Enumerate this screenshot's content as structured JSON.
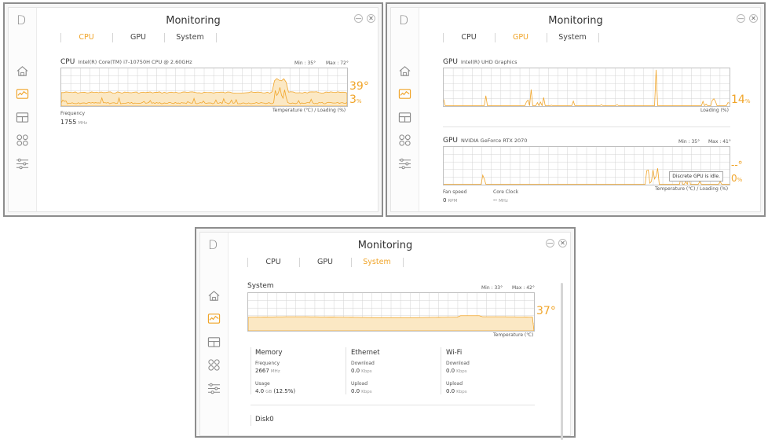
{
  "app": {
    "logo": "D",
    "title": "Monitoring",
    "tabs": [
      "CPU",
      "GPU",
      "System"
    ],
    "minimize_glyph": "—",
    "close_glyph": "✕",
    "nav_icons": [
      "home-icon",
      "monitoring-icon",
      "layout-icon",
      "apps-icon",
      "settings-sliders-icon"
    ]
  },
  "colors": {
    "accent": "#f0a428",
    "grid": "#d2d2d2",
    "panel_border": "#8d8d8d"
  },
  "cpu_view": {
    "active_tab": "CPU",
    "cpu_label": "CPU",
    "cpu_name": "Intel(R) Core(TM) i7-10750H CPU @ 2.60GHz",
    "min_label": "Min : 35°",
    "max_label": "Max : 72°",
    "temp_value": "39°",
    "load_value": "3",
    "load_unit": "%",
    "axis_caption": "Temperature (℃) / Loading (%)",
    "frequency_label": "Frequency",
    "frequency_value": "1755",
    "frequency_unit": "MHz"
  },
  "gpu_view": {
    "active_tab": "GPU",
    "gpu1_label": "GPU",
    "gpu1_name": "Intel(R) UHD Graphics",
    "gpu1_load_value": "14",
    "gpu1_load_unit": "%",
    "gpu1_axis_caption": "Loading (%)",
    "gpu2_label": "GPU",
    "gpu2_name": "NVIDIA GeForce RTX 2070",
    "gpu2_min_label": "Min : 35°",
    "gpu2_max_label": "Max : 41°",
    "gpu2_temp_value": "--°",
    "gpu2_load_value": "0",
    "gpu2_load_unit": "%",
    "gpu2_axis_caption": "Temperature (℃) / Loading (%)",
    "tooltip": "Discrete GPU is idle.",
    "fan_label": "Fan speed",
    "fan_value": "0",
    "fan_unit": "RPM",
    "core_clock_label": "Core Clock",
    "core_clock_value": "--",
    "core_clock_unit": "MHz"
  },
  "system_view": {
    "active_tab": "System",
    "system_label": "System",
    "min_label": "Min : 33°",
    "max_label": "Max : 42°",
    "temp_value": "37°",
    "axis_caption": "Temperature (℃)",
    "memory": {
      "title": "Memory",
      "frequency_label": "Frequency",
      "frequency_value": "2667",
      "frequency_unit": "MHz",
      "usage_label": "Usage",
      "usage_value": "4.0",
      "usage_unit": "GB",
      "usage_pct": "(12.5%)"
    },
    "ethernet": {
      "title": "Ethernet",
      "download_label": "Download",
      "download_value": "0.0",
      "download_unit": "Kbps",
      "upload_label": "Upload",
      "upload_value": "0.0",
      "upload_unit": "Kbps"
    },
    "wifi": {
      "title": "Wi-Fi",
      "download_label": "Download",
      "download_value": "0.0",
      "download_unit": "Kbps",
      "upload_label": "Upload",
      "upload_value": "0.0",
      "upload_unit": "Kbps"
    },
    "disk_title": "Disk0"
  }
}
